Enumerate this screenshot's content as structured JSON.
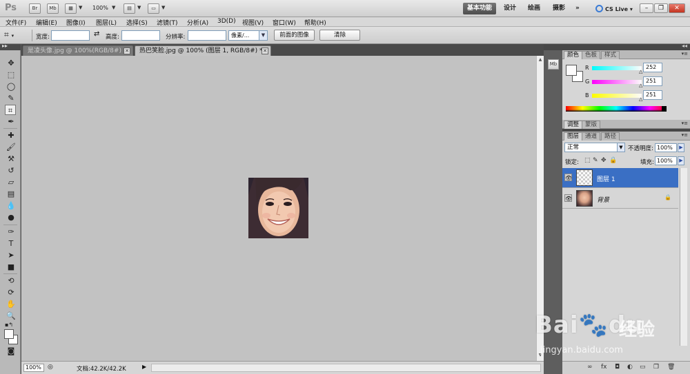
{
  "app": {
    "logo": "Ps",
    "bridge_btn": "Br",
    "minibridge_btn": "Mb",
    "zoom": "100%",
    "workspaces": [
      "基本功能",
      "设计",
      "绘画",
      "摄影"
    ],
    "more": "»",
    "cs_live": "CS Live"
  },
  "menu": [
    "文件(F)",
    "编辑(E)",
    "图像(I)",
    "图层(L)",
    "选择(S)",
    "滤镜(T)",
    "分析(A)",
    "3D(D)",
    "视图(V)",
    "窗口(W)",
    "帮助(H)"
  ],
  "options": {
    "width_label": "宽度:",
    "width_value": "",
    "height_label": "高度:",
    "height_value": "",
    "resolution_label": "分辨率:",
    "resolution_value": "",
    "unit": "像素/...",
    "front_image_btn": "前面的图像",
    "clear_btn": "清除"
  },
  "tabs": [
    {
      "label": "是凌头像.jpg @ 100%(RGB/8#) *",
      "active": false
    },
    {
      "label": "热巴笑脸.jpg @ 100% (图层 1, RGB/8#) *",
      "active": true
    }
  ],
  "status": {
    "zoom": "100%",
    "doc_info": "文档:42.2K/42.2K"
  },
  "color_panel": {
    "tabs": [
      "颜色",
      "色板",
      "样式"
    ],
    "r_label": "R",
    "r": "252",
    "g_label": "G",
    "g": "251",
    "b_label": "B",
    "b": "251",
    "foreground": "#fcfbfb"
  },
  "adjust_panel": {
    "tabs": [
      "调整",
      "蒙版"
    ]
  },
  "layers_panel": {
    "tabs": [
      "图层",
      "通道",
      "路径"
    ],
    "blend_mode": "正常",
    "opacity_label": "不透明度:",
    "opacity": "100%",
    "lock_label": "锁定:",
    "fill_label": "填充:",
    "fill": "100%",
    "layers": [
      {
        "name": "图层 1",
        "selected": true
      },
      {
        "name": "背景",
        "selected": false
      }
    ]
  },
  "watermark": {
    "brand": "Bai",
    "brand2": "du",
    "cn": "经验",
    "url": "jingyan.baidu.com"
  }
}
